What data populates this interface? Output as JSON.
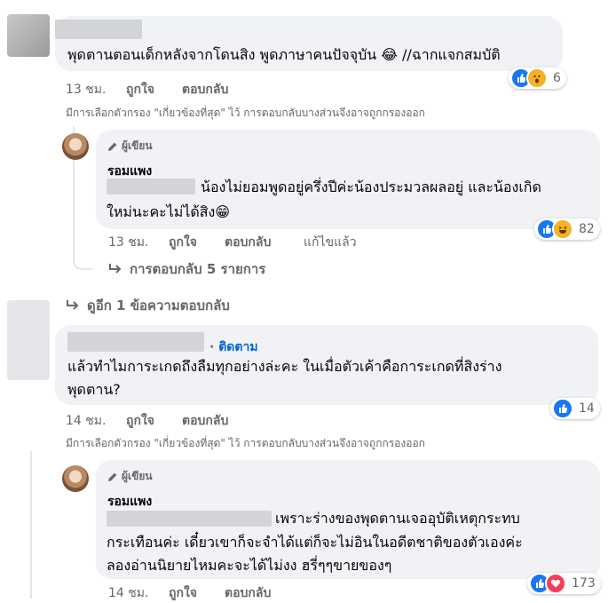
{
  "comment1": {
    "text": "พุดตานตอนเด็กหลังจากโดนสิง พูดภาษาคนปัจจุบัน 😂 //ฉากแจกสมบัติ",
    "time": "13 ชม.",
    "like": "ถูกใจ",
    "reply": "ตอบกลับ",
    "reactions": {
      "count": "6",
      "icons": [
        "like-icon",
        "wow-icon"
      ]
    },
    "filter_note": "มีการเลือกตัวกรอง \"เกี่ยวข้องที่สุด\" ไว้ การตอบกลับบางส่วนจึงอาจถูกกรองออก"
  },
  "reply1": {
    "author_tag": "ผู้เขียน",
    "author": "รอมแพง",
    "line1": "น้องไม่ยอมพูดอยู่ครึ่งปีค่ะน้องประมวลผลอยู่ และน้องเกิด",
    "line2": "ใหม่นะคะไม่ได้สิง😁",
    "time": "13 ชม.",
    "like": "ถูกใจ",
    "reply": "ตอบกลับ",
    "edited": "แก้ไขแล้ว",
    "reactions": {
      "count": "82",
      "icons": [
        "like-icon",
        "haha-icon"
      ]
    },
    "more_replies": "การตอบกลับ 5 รายการ"
  },
  "see_more": "ดูอีก 1 ข้อความตอบกลับ",
  "comment2": {
    "follow": "ติดตาม",
    "line1": "แล้วทำไมการะเกดถึงลืมทุกอย่างล่ะคะ ในเมื่อตัวเค้าคือการะเกดที่สิงร่าง",
    "line2": "พุดตาน?",
    "time": "14 ชม.",
    "like": "ถูกใจ",
    "reply": "ตอบกลับ",
    "reactions": {
      "count": "14",
      "icons": [
        "like-icon"
      ]
    },
    "filter_note": "มีการเลือกตัวกรอง \"เกี่ยวข้องที่สุด\" ไว้ การตอบกลับบางส่วนจึงอาจถูกกรองออก"
  },
  "reply2": {
    "author_tag": "ผู้เขียน",
    "author": "รอมแพง",
    "line1": "เพราะร่างของพุดตานเจออุบัติเหตุกระทบ",
    "line2": "กระเทือนค่ะ เดี๋ยวเขาก็จะจำได้แต่ก็จะไม่อินในอดีตชาติของตัวเองค่ะ",
    "line3": "ลองอ่านนิยายไหมคะจะได้ไม่งง ฮรี่ๆๆขายของๆ",
    "time": "14 ชม.",
    "like": "ถูกใจ",
    "reply": "ตอบกลับ",
    "reactions": {
      "count": "173",
      "icons": [
        "like-icon",
        "love-icon"
      ]
    }
  },
  "colors": {
    "bubble": "#f0f2f5",
    "meta": "#65676b",
    "link": "#0064d1",
    "like": "#1877f2",
    "love": "#f33e58",
    "haha": "#f7b125"
  }
}
